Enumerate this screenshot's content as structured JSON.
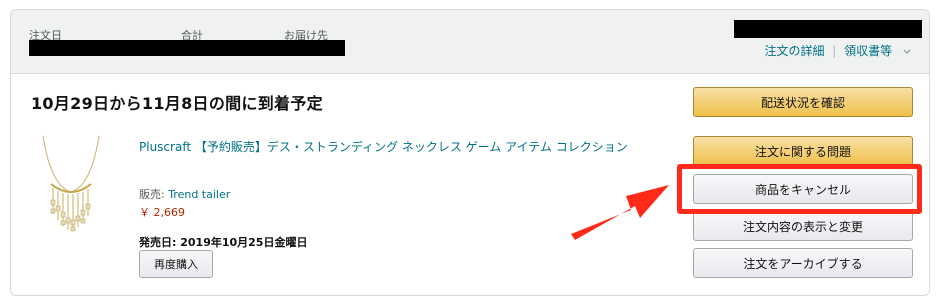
{
  "order_header": {
    "order_date_label": "注文日",
    "total_label": "合計",
    "ship_to_label": "お届け先",
    "order_details_link": "注文の詳細",
    "receipt_link": "領収書等",
    "separator": "|"
  },
  "shipment": {
    "delivery_estimate": "10月29日から11月8日の間に到着予定"
  },
  "item": {
    "title": "Pluscraft 【予約販売】デス・ストランディング ネックレス ゲーム アイテム コレクション",
    "seller_prefix": "販売: ",
    "seller_name": "Trend tailer",
    "price": "￥ 2,669",
    "release_date": "発売日: 2019年10月25日金曜日",
    "buy_again_label": "再度購入"
  },
  "actions": {
    "track_package": "配送状況を確認",
    "problem_with_order": "注文に関する問題",
    "cancel_items": "商品をキャンセル",
    "view_or_edit_order": "注文内容の表示と変更",
    "archive_order": "注文をアーカイブする"
  },
  "colors": {
    "annotation_red": "#ff2a1a",
    "link_teal": "#007185",
    "price_red": "#b12704",
    "primary_button_yellow": "#f0c14b"
  }
}
